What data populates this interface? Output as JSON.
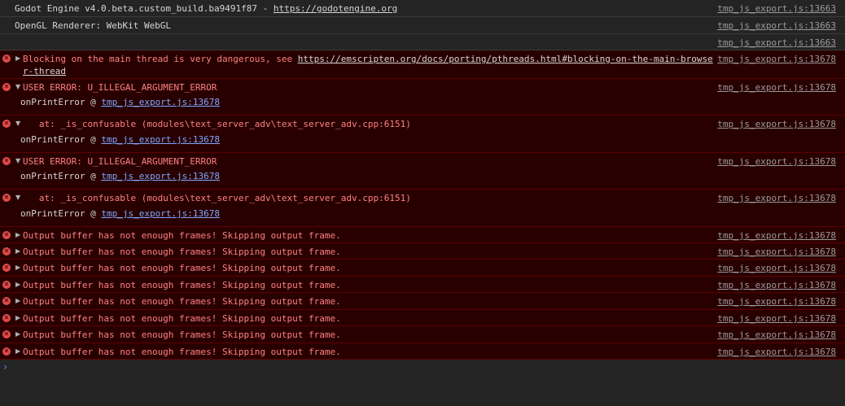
{
  "rows": [
    {
      "type": "log",
      "text": "Godot Engine v4.0.beta.custom_build.ba9491f87 - ",
      "link": "https://godotengine.org",
      "source": "tmp_js_export.js:13663"
    },
    {
      "type": "log",
      "text": "OpenGL Renderer: WebKit WebGL",
      "source": "tmp_js_export.js:13663"
    },
    {
      "type": "log",
      "text": "",
      "source": "tmp_js_export.js:13663"
    },
    {
      "type": "error",
      "text": "Blocking on the main thread is very dangerous, see ",
      "link": "https://emscripten.org/docs/porting/pthreads.html#blocking-on-the-main-browse",
      "link_cont": "r-thread",
      "source": "tmp_js_export.js:13678"
    },
    {
      "type": "error",
      "text": "USER ERROR: U_ILLEGAL_ARGUMENT_ERROR",
      "stack_fn": "onPrintError @ ",
      "stack_link": "tmp_js_export.js:13678",
      "source": "tmp_js_export.js:13678"
    },
    {
      "type": "error",
      "text": "   at: _is_confusable (modules\\text_server_adv\\text_server_adv.cpp:6151)",
      "stack_fn": "onPrintError @ ",
      "stack_link": "tmp_js_export.js:13678",
      "source": "tmp_js_export.js:13678"
    },
    {
      "type": "error",
      "text": "USER ERROR: U_ILLEGAL_ARGUMENT_ERROR",
      "stack_fn": "onPrintError @ ",
      "stack_link": "tmp_js_export.js:13678",
      "source": "tmp_js_export.js:13678"
    },
    {
      "type": "error",
      "text": "   at: _is_confusable (modules\\text_server_adv\\text_server_adv.cpp:6151)",
      "stack_fn": "onPrintError @ ",
      "stack_link": "tmp_js_export.js:13678",
      "source": "tmp_js_export.js:13678"
    },
    {
      "type": "error",
      "text": "Output buffer has not enough frames! Skipping output frame.",
      "source": "tmp_js_export.js:13678"
    },
    {
      "type": "error",
      "text": "Output buffer has not enough frames! Skipping output frame.",
      "source": "tmp_js_export.js:13678"
    },
    {
      "type": "error",
      "text": "Output buffer has not enough frames! Skipping output frame.",
      "source": "tmp_js_export.js:13678"
    },
    {
      "type": "error",
      "text": "Output buffer has not enough frames! Skipping output frame.",
      "source": "tmp_js_export.js:13678"
    },
    {
      "type": "error",
      "text": "Output buffer has not enough frames! Skipping output frame.",
      "source": "tmp_js_export.js:13678"
    },
    {
      "type": "error",
      "text": "Output buffer has not enough frames! Skipping output frame.",
      "source": "tmp_js_export.js:13678"
    },
    {
      "type": "error",
      "text": "Output buffer has not enough frames! Skipping output frame.",
      "source": "tmp_js_export.js:13678"
    },
    {
      "type": "error",
      "text": "Output buffer has not enough frames! Skipping output frame.",
      "source": "tmp_js_export.js:13678"
    }
  ],
  "icons": {
    "error": "error-circle-icon",
    "expand": "disclosure-triangle-icon",
    "prompt": "console-prompt-icon"
  },
  "colors": {
    "background": "#242424",
    "error_background": "#290000",
    "error_text": "#ff8080",
    "error_icon": "#e24a4a",
    "prompt": "#3d8be0"
  },
  "prompt_symbol": "›"
}
